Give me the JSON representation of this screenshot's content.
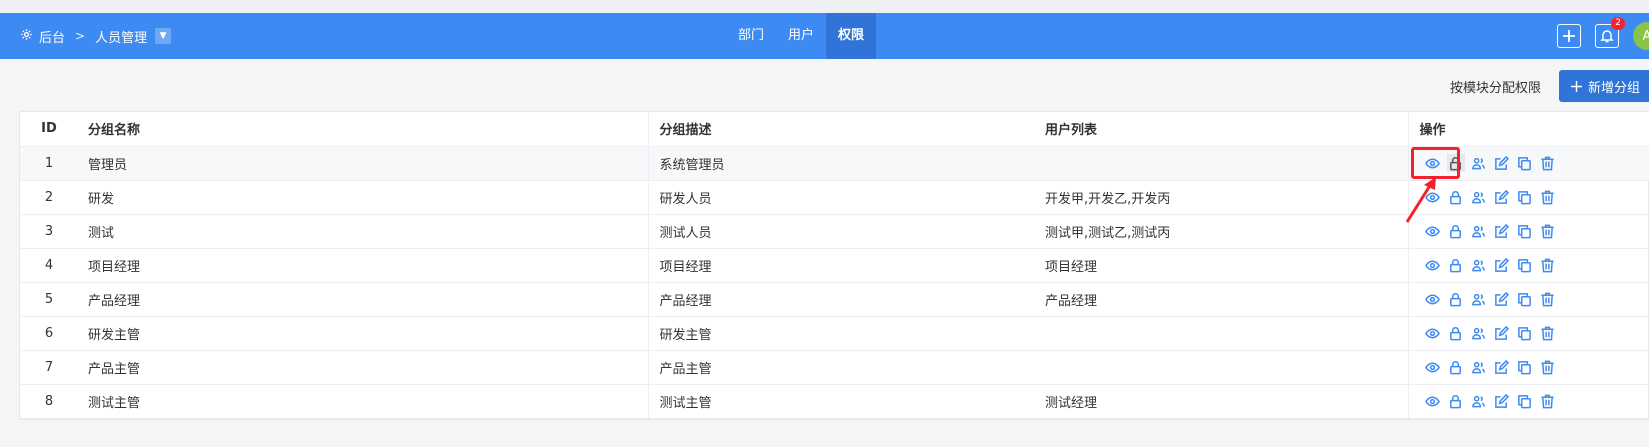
{
  "topbar": {
    "breadcrumbs": [
      "后台",
      "人员管理"
    ],
    "tabs": [
      {
        "label": "部门",
        "active": false
      },
      {
        "label": "用户",
        "active": false
      },
      {
        "label": "权限",
        "active": true
      }
    ],
    "notification_count": "2",
    "avatar_initial": "A"
  },
  "toolbar": {
    "assign_label": "按模块分配权限",
    "add_label": "新增分组"
  },
  "table": {
    "headers": {
      "id": "ID",
      "name": "分组名称",
      "desc": "分组描述",
      "users": "用户列表",
      "ops": "操作"
    },
    "rows": [
      {
        "id": "1",
        "name": "管理员",
        "desc": "系统管理员",
        "users": ""
      },
      {
        "id": "2",
        "name": "研发",
        "desc": "研发人员",
        "users": "开发甲,开发乙,开发丙"
      },
      {
        "id": "3",
        "name": "测试",
        "desc": "测试人员",
        "users": "测试甲,测试乙,测试丙"
      },
      {
        "id": "4",
        "name": "项目经理",
        "desc": "项目经理",
        "users": "项目经理"
      },
      {
        "id": "5",
        "name": "产品经理",
        "desc": "产品经理",
        "users": "产品经理"
      },
      {
        "id": "6",
        "name": "研发主管",
        "desc": "研发主管",
        "users": ""
      },
      {
        "id": "7",
        "name": "产品主管",
        "desc": "产品主管",
        "users": ""
      },
      {
        "id": "8",
        "name": "测试主管",
        "desc": "测试主管",
        "users": "测试经理"
      }
    ],
    "row_actions": [
      "view-icon",
      "lock-icon",
      "users-icon",
      "edit-icon",
      "copy-icon",
      "delete-icon"
    ]
  },
  "colors": {
    "accent": "#3d8bf2",
    "highlight": "#f5222d"
  }
}
